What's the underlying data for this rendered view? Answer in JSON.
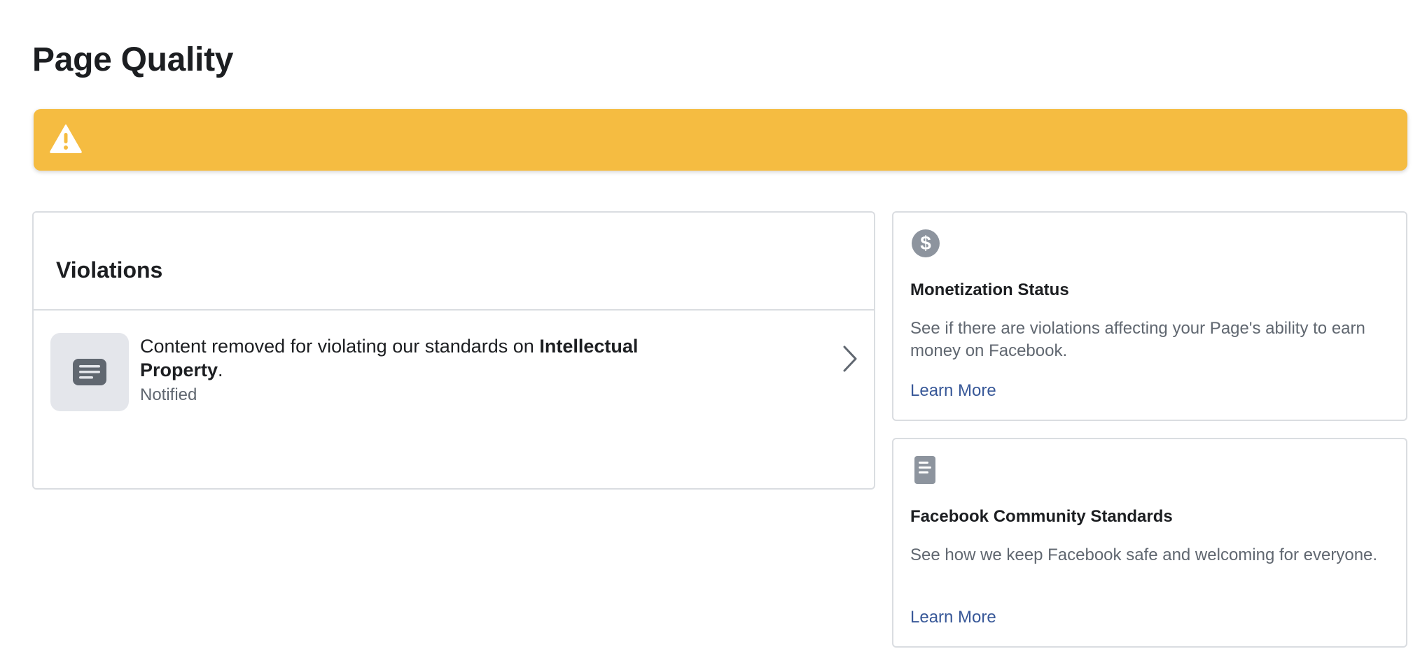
{
  "page": {
    "title": "Page Quality"
  },
  "banner": {
    "icon": "warning-triangle-icon",
    "color": "#f5bc41"
  },
  "violations": {
    "title": "Violations",
    "items": [
      {
        "icon": "message-icon",
        "text_before": "Content removed for violating our standards on ",
        "text_bold": "Intellectual Property",
        "text_after": ".",
        "meta": "Notified"
      }
    ]
  },
  "monetization": {
    "icon": "dollar-icon",
    "title": "Monetization Status",
    "description": "See if there are violations affecting your Page's ability to earn money on Facebook.",
    "link": "Learn More"
  },
  "standards": {
    "icon": "document-icon",
    "title": "Facebook Community Standards",
    "description": "See how we keep Facebook safe and welcoming for everyone.",
    "link": "Learn More"
  },
  "colors": {
    "text_primary": "#1c1e21",
    "text_secondary": "#606770",
    "link": "#385898",
    "border": "#dadde1",
    "icon_gray": "#8d949e"
  }
}
